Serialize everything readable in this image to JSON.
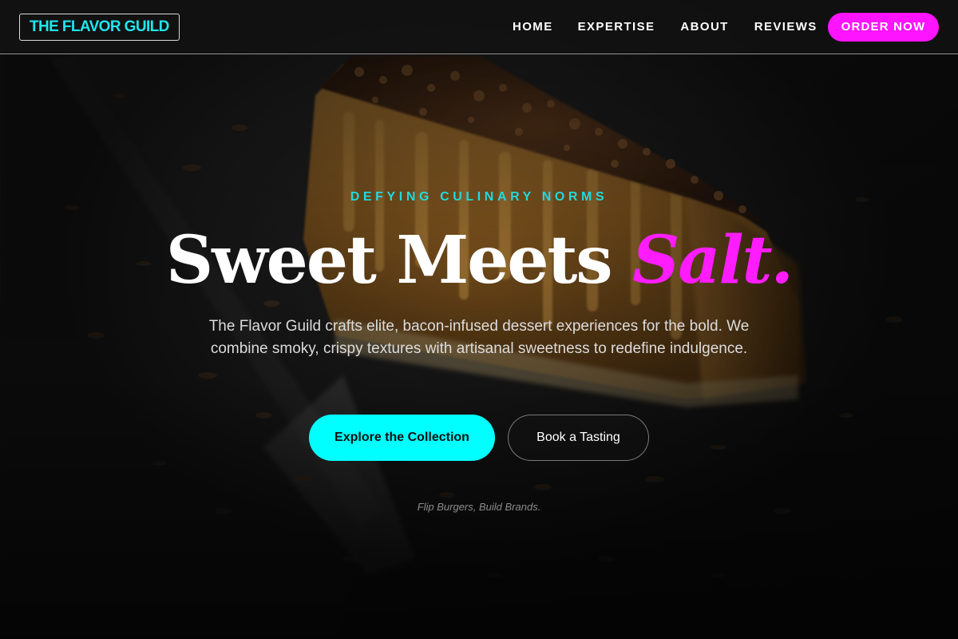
{
  "brand": {
    "logo_text": "THE FLAVOR GUILD"
  },
  "nav": {
    "items": [
      {
        "label": "HOME"
      },
      {
        "label": "EXPERTISE"
      },
      {
        "label": "ABOUT"
      },
      {
        "label": "REVIEWS"
      }
    ],
    "order_label": "ORDER NOW"
  },
  "hero": {
    "eyebrow": "DEFYING CULINARY NORMS",
    "headline_main": "Sweet Meets",
    "headline_accent": "Salt.",
    "description": "The Flavor Guild crafts elite, bacon-infused dessert experiences for the bold. We combine smoky, crispy textures with artisanal sweetness to redefine indulgence.",
    "primary_cta": "Explore the Collection",
    "secondary_cta": "Book a Tasting",
    "tagline": "Flip Burgers, Build Brands."
  },
  "colors": {
    "accent_cyan": "#00ffff",
    "accent_magenta": "#ff14ff",
    "background": "#141414"
  },
  "icons": {
    "hero_image": "cheesecake-photo"
  }
}
